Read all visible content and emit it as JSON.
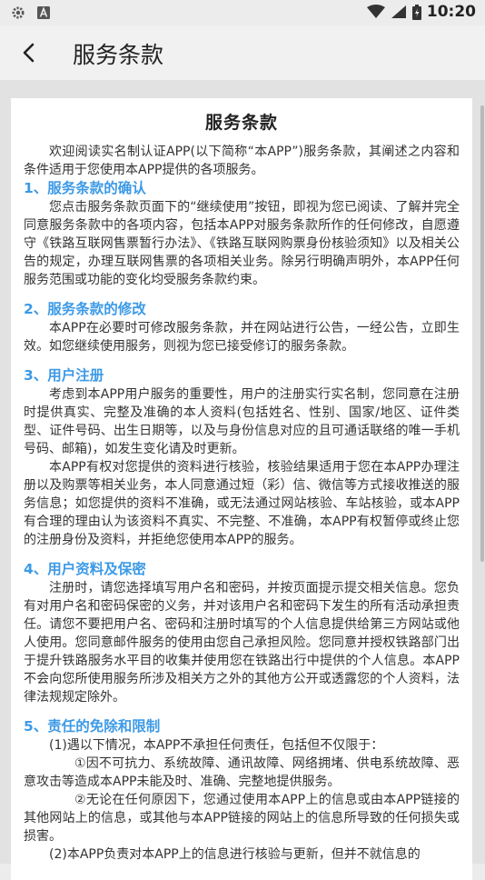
{
  "status_bar": {
    "time": "10:20",
    "left_icons": [
      "settings-gear-icon",
      "a-square-icon"
    ],
    "right_icons": [
      "wifi-icon",
      "signal-icon",
      "battery-icon"
    ]
  },
  "app_bar": {
    "title": "服务条款"
  },
  "document": {
    "title": "服务条款",
    "intro": "欢迎阅读实名制认证APP(以下简称“本APP”)服务条款，其阐述之内容和条件适用于您使用本APP提供的各项服务。",
    "sections": [
      {
        "heading": "1、服务条款的确认",
        "paragraphs": [
          "您点击服务条款页面下的“继续使用”按钮，即视为您已阅读、了解并完全同意服务条款中的各项内容，包括本APP对服务条款所作的任何修改，自愿遵守《铁路互联网售票暂行办法》、《铁路互联网购票身份核验须知》以及相关公告的规定，办理互联网售票的各项相关业务。除另行明确声明外，本APP任何服务范围或功能的变化均受服务条款约束。"
        ]
      },
      {
        "heading": "2、服务条款的修改",
        "paragraphs": [
          "本APP在必要时可修改服务条款，并在网站进行公告，一经公告，立即生效。如您继续使用服务，则视为您已接受修订的服务条款。"
        ]
      },
      {
        "heading": "3、用户注册",
        "paragraphs": [
          "考虑到本APP用户服务的重要性，用户的注册实行实名制，您同意在注册时提供真实、完整及准确的本人资料(包括姓名、性别、国家/地区、证件类型、证件号码、出生日期等，以及与身份信息对应的且可通话联络的唯一手机号码、邮箱)，如发生变化请及时更新。",
          "本APP有权对您提供的资料进行核验，核验结果适用于您在本APP办理注册以及购票等相关业务，本人同意通过短（彩）信、微信等方式接收推送的服务信息；如您提供的资料不准确，或无法通过网站核验、车站核验，或本APP有合理的理由认为该资料不真实、不完整、不准确，本APP有权暂停或终止您的注册身份及资料，并拒绝您使用本APP的服务。"
        ]
      },
      {
        "heading": "4、用户资料及保密",
        "paragraphs": [
          "注册时，请您选择填写用户名和密码，并按页面提示提交相关信息。您负有对用户名和密码保密的义务，并对该用户名和密码下发生的所有活动承担责任。请您不要把用户名、密码和注册时填写的个人信息提供给第三方网站或他人使用。您同意邮件服务的使用由您自己承担风险。您同意并授权铁路部门出于提升铁路服务水平目的收集并使用您在铁路出行中提供的个人信息。本APP不会向您所使用服务所涉及相关方之外的其他方公开或透露您的个人资料，法律法规规定除外。"
        ]
      },
      {
        "heading": "5、责任的免除和限制",
        "items": [
          "(1)遇以下情况，本APP不承担任何责任，包括但不仅限于：",
          "①因不可抗力、系统故障、通讯故障、网络拥堵、供电系统故障、恶意攻击等造成本APP未能及时、准确、完整地提供服务。",
          "②无论在任何原因下，您通过使用本APP上的信息或由本APP链接的其他网站上的信息，或其他与本APP链接的网站上的信息所导致的任何损失或损害。",
          "(2)本APP负责对本APP上的信息进行核验与更新，但并不就信息的"
        ]
      }
    ]
  }
}
